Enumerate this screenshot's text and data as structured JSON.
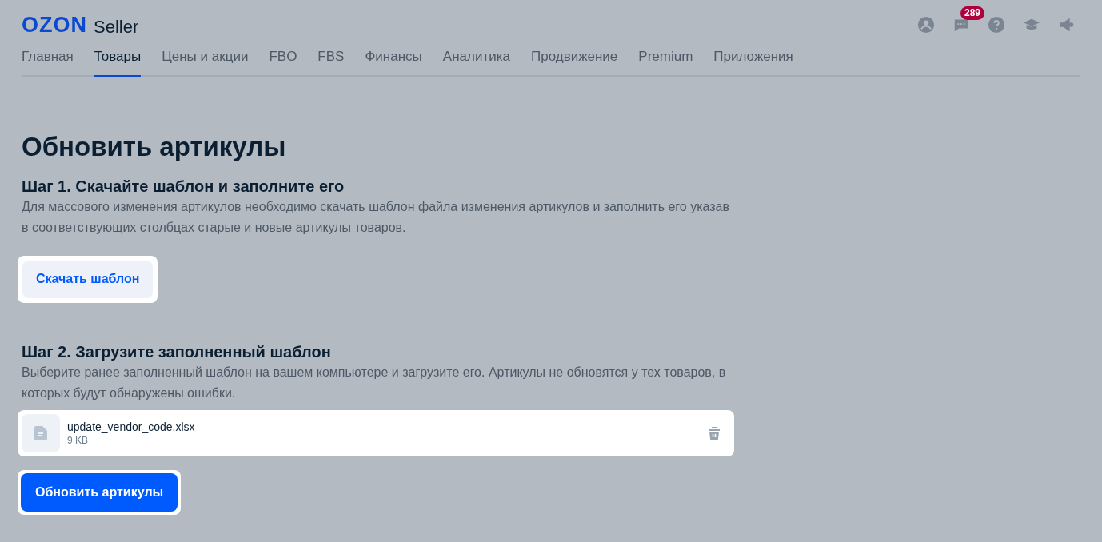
{
  "header": {
    "logo": "OZON",
    "logo_suffix": "Seller",
    "notifications_badge": "289"
  },
  "nav": [
    {
      "label": "Главная",
      "selected": false
    },
    {
      "label": "Товары",
      "selected": true
    },
    {
      "label": "Цены и акции",
      "selected": false
    },
    {
      "label": "FBO",
      "selected": false
    },
    {
      "label": "FBS",
      "selected": false
    },
    {
      "label": "Финансы",
      "selected": false
    },
    {
      "label": "Аналитика",
      "selected": false
    },
    {
      "label": "Продвижение",
      "selected": false
    },
    {
      "label": "Premium",
      "selected": false
    },
    {
      "label": "Приложения",
      "selected": false
    }
  ],
  "title": "Обновить артикулы",
  "step1": {
    "heading": "Шаг 1. Скачайте шаблон и заполните его",
    "text": "Для массового изменения артикулов необходимо скачать шаблон файла изменения артикулов и заполнить его указав в соответствующих столбцах старые и новые артикулы товаров.",
    "button": "Скачать шаблон"
  },
  "step2": {
    "heading": "Шаг 2. Загрузите заполненный шаблон",
    "text": "Выберите ранее заполненный шаблон на вашем компьютере и загрузите его. Артикулы не обновятся у тех товаров, в которых будут обнаружены ошибки.",
    "file": {
      "name": "update_vendor_code.xlsx",
      "size": "9 KB"
    },
    "button": "Обновить артикулы"
  }
}
